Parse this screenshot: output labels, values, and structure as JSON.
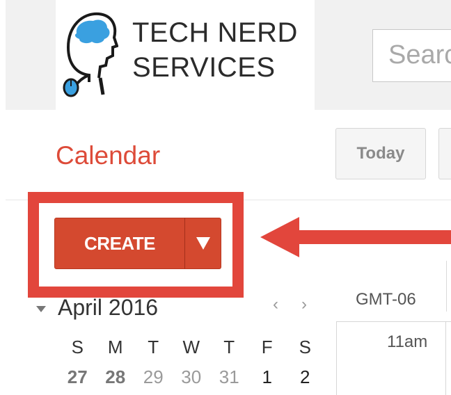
{
  "header": {
    "logo_line1": "TECH NERD",
    "logo_line2": "SERVICES",
    "search_placeholder": "Search"
  },
  "toolbar": {
    "app_title": "Calendar",
    "today_label": "Today"
  },
  "create": {
    "label": "CREATE",
    "dropdown_icon": "caret-down-icon"
  },
  "mini_calendar": {
    "month": "April 2016",
    "prev_icon": "chevron-left-icon",
    "next_icon": "chevron-right-icon",
    "weekdays": [
      "S",
      "M",
      "T",
      "W",
      "T",
      "F",
      "S"
    ],
    "days": [
      "27",
      "28",
      "29",
      "30",
      "31",
      "1",
      "2"
    ]
  },
  "week_view": {
    "timezone": "GMT-06",
    "first_time": "11am"
  },
  "colors": {
    "accent": "#dd4b39",
    "create_button": "#d4492f",
    "annotation": "#e2463c"
  }
}
